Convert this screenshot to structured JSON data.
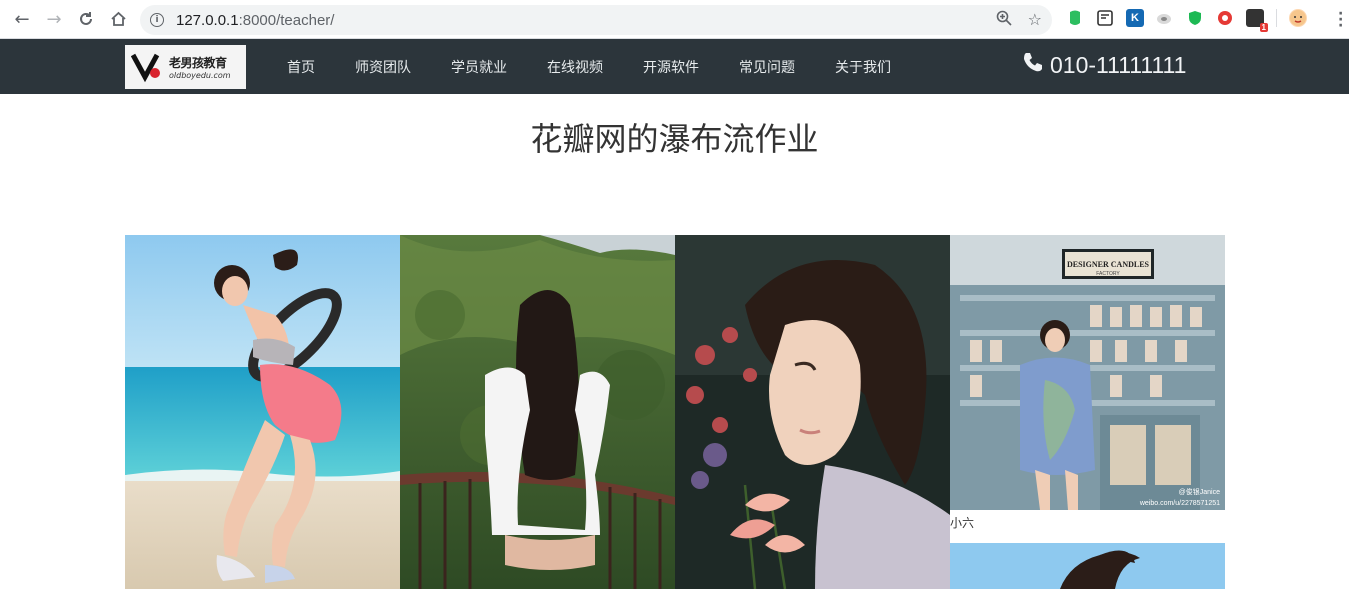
{
  "browser": {
    "url_host": "127.0.0.1",
    "url_path": ":8000/teacher/",
    "extension_badge": "1"
  },
  "navbar": {
    "logo_cn": "老男孩教育",
    "logo_en": "oldboyedu.com",
    "items": [
      "首页",
      "师资团队",
      "学员就业",
      "在线视频",
      "开源软件",
      "常见问题",
      "关于我们"
    ],
    "phone": "010-11111111"
  },
  "page": {
    "title": "花瓣网的瀑布流作业"
  },
  "cards": [
    {
      "caption": ""
    },
    {
      "caption": ""
    },
    {
      "caption": ""
    },
    {
      "caption": "小六",
      "watermark": "@俊银Janice\nweibo.com/u/2278571251"
    },
    {
      "caption": ""
    }
  ],
  "colors": {
    "navbar_bg": "#2c353b",
    "omnibox_bg": "#f1f3f4"
  }
}
